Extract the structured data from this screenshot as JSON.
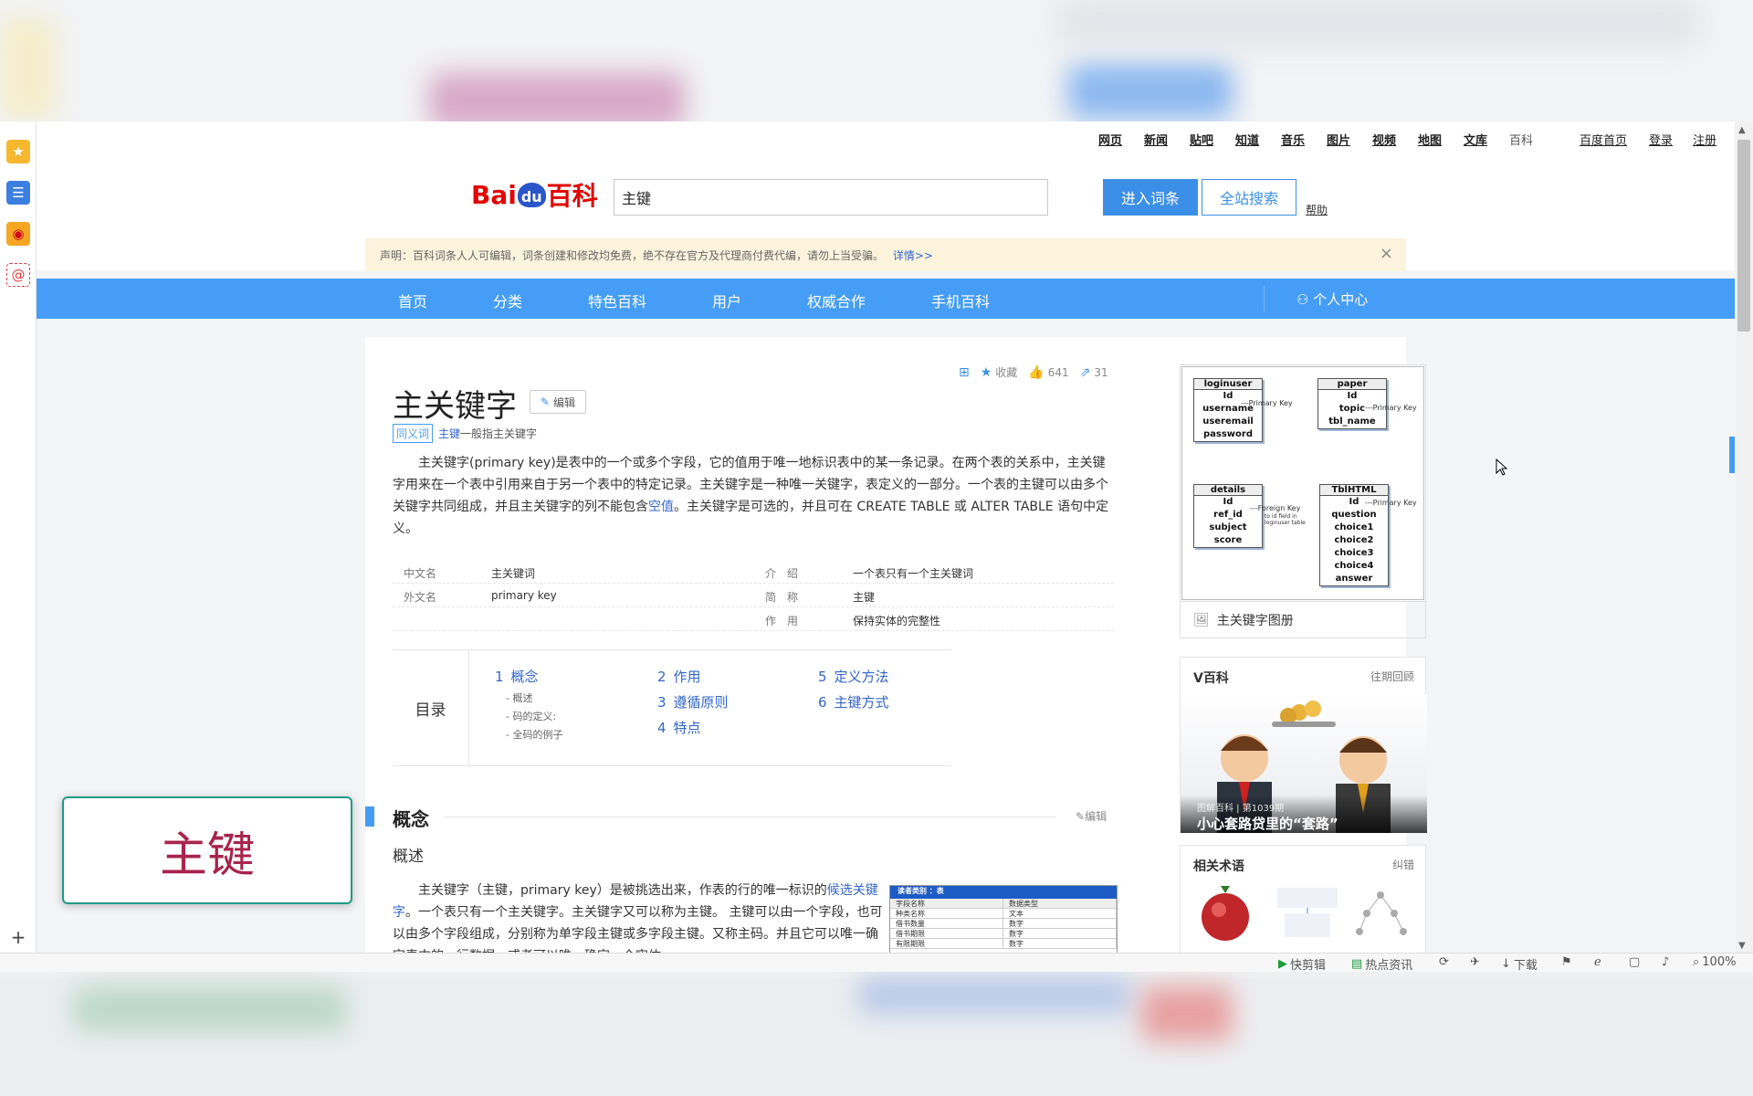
{
  "top_nav": [
    "网页",
    "新闻",
    "贴吧",
    "知道",
    "音乐",
    "图片",
    "视频",
    "地图",
    "文库",
    "百科"
  ],
  "top_right": [
    "百度首页",
    "登录",
    "注册"
  ],
  "logo": {
    "bai": "Bai",
    "du": "du",
    "baike": "百科"
  },
  "search": {
    "value": "主键",
    "enter_label": "进入词条",
    "site_label": "全站搜索",
    "help_label": "帮助"
  },
  "notice": {
    "text": "声明：百科词条人人可编辑，词条创建和修改均免费，绝不存在官方及代理商付费代编，请勿上当受骗。",
    "link": "详情>>"
  },
  "blue_nav": [
    "首页",
    "分类",
    "特色百科",
    "用户",
    "权威合作",
    "手机百科"
  ],
  "personal_center": "个人中心",
  "toolbar": {
    "collect": "收藏",
    "likes": "641",
    "shares": "31"
  },
  "article": {
    "title": "主关键字",
    "edit_label": "编辑",
    "synonym_tag": "同义词",
    "synonym_link": "主键",
    "synonym_text": "一般指主关键字",
    "intro_a": "主关键字(primary key)是表中的一个或多个字段，它的值用于唯一地标识表中的某一条记录。在两个表的关系中，主关键字用来在一个表中引用来自于另一个表中的特定记录。主关键字是一种唯一关键字，表定义的一部分。一个表的主键可以由多个关键字共同组成，并且主关键字的列不能包含",
    "intro_link": "空值",
    "intro_b": "。主关键字是可选的，并且可在 CREATE TABLE 或 ALTER TABLE 语句中定义。"
  },
  "basic_info": [
    {
      "k": "中文名",
      "v": "主关键词"
    },
    {
      "k": "外文名",
      "v": "primary key"
    },
    {
      "k": "介　绍",
      "v": "一个表只有一个主关键词"
    },
    {
      "k": "简　称",
      "v": "主键"
    },
    {
      "k": "作　用",
      "v": "保持实体的完整性"
    }
  ],
  "toc": {
    "label": "目录",
    "items": [
      {
        "n": "1",
        "t": "概念"
      },
      {
        "n": "2",
        "t": "作用"
      },
      {
        "n": "3",
        "t": "遵循原则"
      },
      {
        "n": "4",
        "t": "特点"
      },
      {
        "n": "5",
        "t": "定义方法"
      },
      {
        "n": "6",
        "t": "主键方式"
      }
    ],
    "subs": [
      "概述",
      "码的定义:",
      "全码的例子"
    ]
  },
  "section": {
    "title": "概念",
    "edit": "编辑",
    "sub": "概述",
    "text_a": "主关键字（主键，primary key）是被挑选出来，作表的行的唯一标识的",
    "text_link": "候选关键字",
    "text_b": "。一个表只有一个主关键字。主关键字又可以称为主键。 主键可以由一个字段，也可以由多个字段组成，分别称为单字段主键或多字段主键。又称主码。并且它可以唯一确定表中的一行数据，或者可以唯一确定一个实体。"
  },
  "table_img": {
    "title": "读者类别 ：表",
    "headers": [
      "字段名称",
      "数据类型"
    ],
    "rows": [
      [
        "种类名称",
        "文本"
      ],
      [
        "借书数量",
        "数字"
      ],
      [
        "借书期限",
        "数字"
      ],
      [
        "有限期限",
        "数字"
      ]
    ]
  },
  "album": {
    "caption": "主关键字图册",
    "entities": [
      {
        "name": "loginuser",
        "fields": [
          "Id",
          "username",
          "useremail",
          "password"
        ]
      },
      {
        "name": "paper",
        "fields": [
          "Id",
          "topic",
          "tbl_name"
        ]
      },
      {
        "name": "details",
        "fields": [
          "Id",
          "ref_id",
          "subject",
          "score"
        ]
      },
      {
        "name": "TblHTML",
        "fields": [
          "Id",
          "question",
          "choice1",
          "choice2",
          "choice3",
          "choice4",
          "answer"
        ]
      }
    ],
    "pk_label": "---Primary Key",
    "pk_label2": "---Primary Key",
    "pk_label3": "---Primary Key",
    "fk_label": "---Foreign Key",
    "fk_note": "to id field in loginuser table"
  },
  "vbaike": {
    "title": "V百科",
    "more": "往期回顾",
    "meta": "图解百科 | 第1039期",
    "headline": "小心套路贷里的“套路”"
  },
  "terms": {
    "title": "相关术语",
    "more": "纠错"
  },
  "share": {
    "label": "分享"
  },
  "card": {
    "text": "主键"
  },
  "statusbar": {
    "kuaijianji": "快剪辑",
    "news": "热点资讯",
    "download": "下载",
    "zoom": "100%"
  }
}
